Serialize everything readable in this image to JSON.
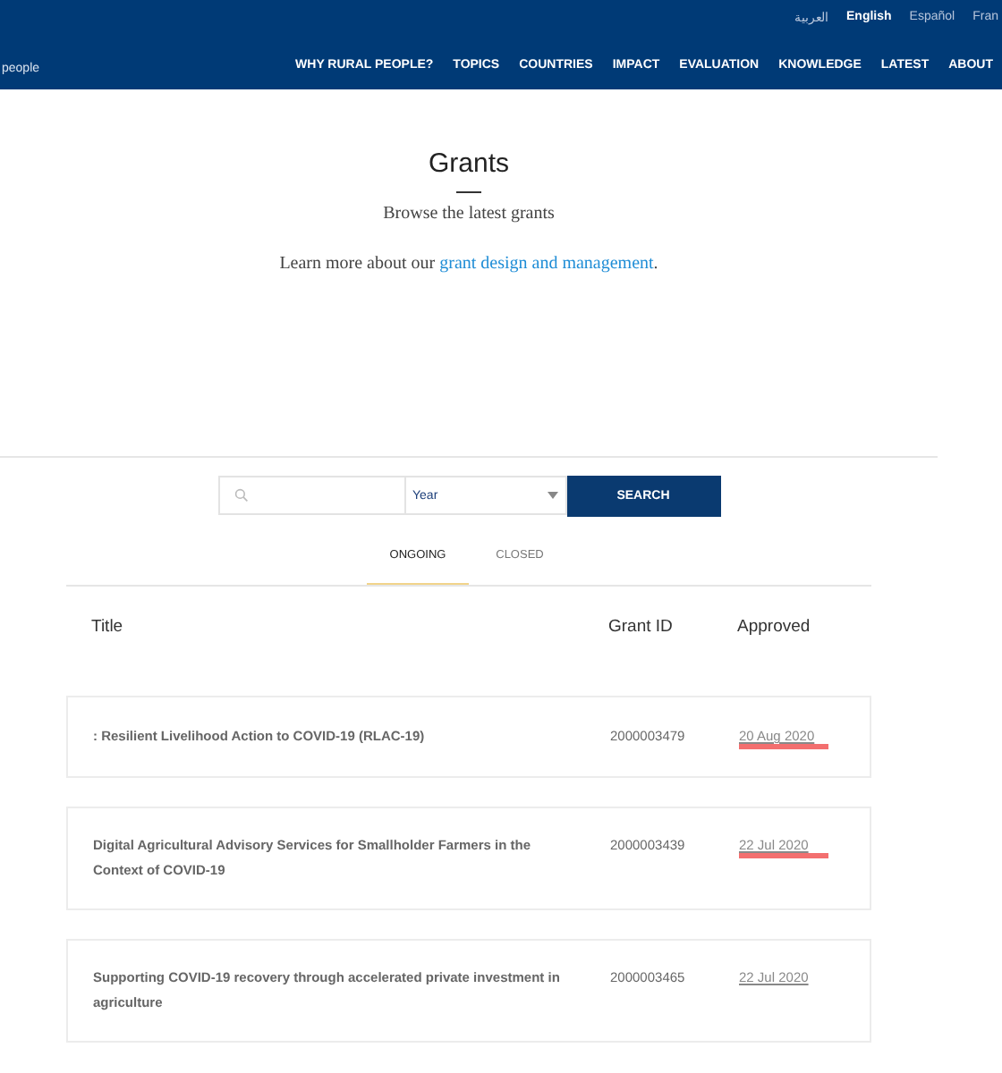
{
  "header": {
    "brand_fragment": "people",
    "languages": [
      {
        "label": "العربية",
        "selected": false
      },
      {
        "label": "English",
        "selected": true
      },
      {
        "label": "Español",
        "selected": false
      },
      {
        "label": "Fran",
        "selected": false
      }
    ],
    "nav": [
      "WHY RURAL PEOPLE?",
      "TOPICS",
      "COUNTRIES",
      "IMPACT",
      "EVALUATION",
      "KNOWLEDGE",
      "LATEST",
      "ABOUT"
    ]
  },
  "title": "Grants",
  "subtitle": "Browse the latest grants",
  "intro": {
    "text": "Learn more about our",
    "link": "grant design and management",
    "end": "."
  },
  "search": {
    "year": "Year",
    "button": "SEARCH"
  },
  "tabs": [
    {
      "label": "ONGOING",
      "selected": true
    },
    {
      "label": "CLOSED",
      "selected": false
    }
  ],
  "table": {
    "columns": [
      "Title",
      "Grant ID",
      "Approved"
    ],
    "rows": [
      {
        "title": ": Resilient Livelihood Action to COVID-19 (RLAC-19)",
        "grant_id": "2000003479",
        "approved": "20 Aug 2020",
        "marked": true
      },
      {
        "title": "Digital Agricultural Advisory Services for Smallholder Farmers in the Context of COVID-19",
        "grant_id": "2000003439",
        "approved": "22 Jul 2020",
        "marked": true
      },
      {
        "title": "Supporting COVID-19 recovery through accelerated private investment in agriculture",
        "grant_id": "2000003465",
        "approved": "22 Jul 2020",
        "marked": false
      }
    ]
  }
}
